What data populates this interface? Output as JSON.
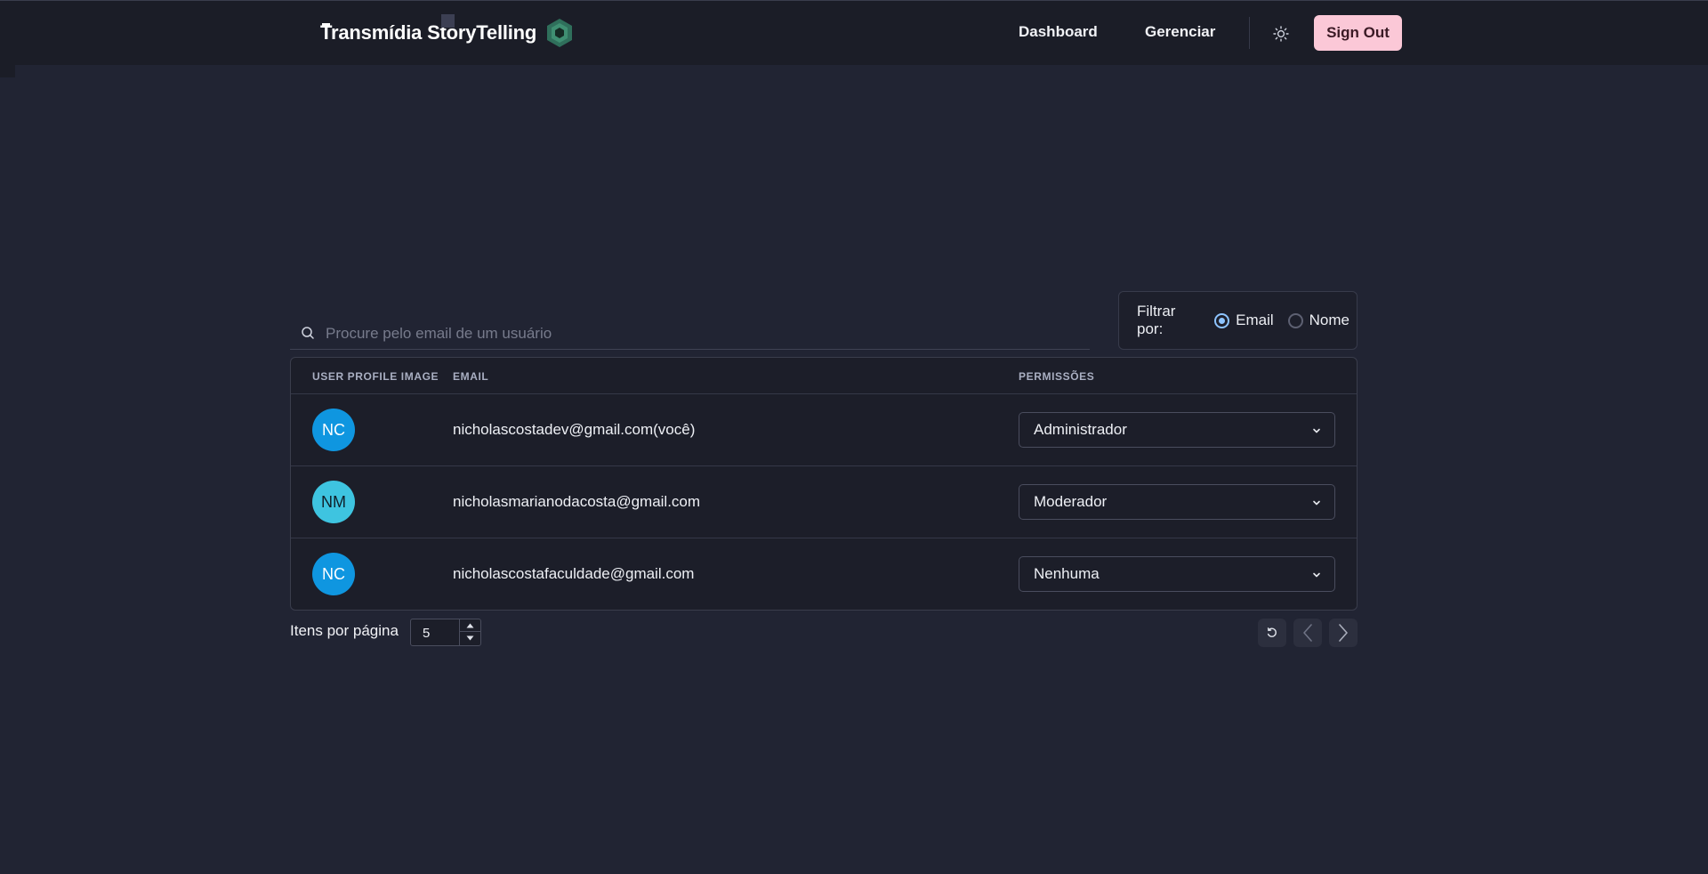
{
  "header": {
    "brand_text": "Transmídia StoryTelling",
    "nav": [
      {
        "label": "Dashboard"
      },
      {
        "label": "Gerenciar"
      }
    ],
    "theme_icon": "sun-icon",
    "signout_label": "Sign Out",
    "signout_color": "#fbc8d7"
  },
  "search": {
    "placeholder": "Procure pelo email de um usuário",
    "value": "",
    "icon": "search-icon"
  },
  "filter": {
    "label": "Filtrar por:",
    "options": [
      {
        "label": "Email",
        "checked": true
      },
      {
        "label": "Nome",
        "checked": false
      }
    ],
    "accent": "#8ec4ff"
  },
  "table": {
    "headers": [
      "USER PROFILE IMAGE",
      "EMAIL",
      "PERMISSÕES"
    ],
    "rows": [
      {
        "initials": "NC",
        "avatar_color": "#0f96e0",
        "email": "nicholascostadev@gmail.com(você)",
        "permission": "Administrador"
      },
      {
        "initials": "NM",
        "avatar_color": "#3ec4e0",
        "email": "nicholasmarianodacosta@gmail.com",
        "permission": "Moderador"
      },
      {
        "initials": "NC",
        "avatar_color": "#0f96e0",
        "email": "nicholascostafaculdade@gmail.com",
        "permission": "Nenhuma"
      }
    ]
  },
  "pagination": {
    "items_per_page_label": "Itens por página",
    "items_per_page_value": "5",
    "buttons": [
      "refresh-icon",
      "chevron-left-icon",
      "chevron-right-icon"
    ]
  },
  "colors": {
    "background": "#212433",
    "topbar": "#1b1d27",
    "table_bg": "#1c1e29"
  }
}
